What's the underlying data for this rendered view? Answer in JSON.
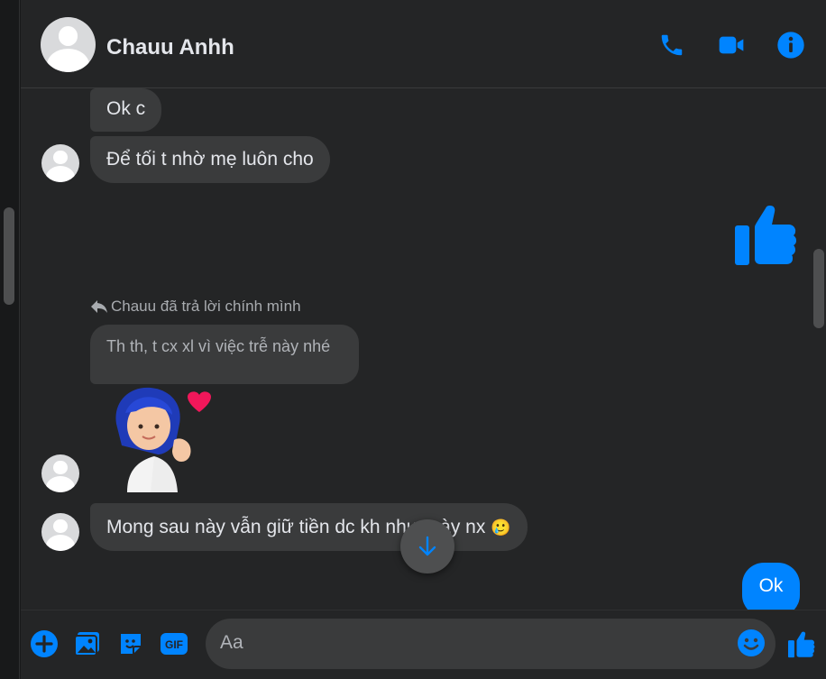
{
  "conversation": {
    "contact_name": "Chauu Anhh",
    "actions": [
      {
        "name": "call",
        "icon": "phone-icon"
      },
      {
        "name": "video",
        "icon": "video-camera-icon"
      },
      {
        "name": "info",
        "icon": "info-icon"
      }
    ]
  },
  "messages": {
    "m1": "Ok c",
    "m2": "Để tối t nhờ mẹ luôn cho",
    "reply_indicator": "Chauu đã trả lời chính mình",
    "m3_quoted": "Th th, t cx xl vì việc trễ này nhé",
    "m4": "Mong sau này vẫn giữ tiền dc kh nhưt này nx",
    "m4_emoji": "🥲",
    "sent_ok": "Ok",
    "sent_sticker": "thumbs-up-icon",
    "received_sticker": "blue-hair-girl-heart-sticker"
  },
  "composer": {
    "placeholder": "Aa",
    "buttons": [
      "plus-icon",
      "image-icon",
      "sticker-icon",
      "gif-icon",
      "emoji-icon",
      "thumbs-up-icon"
    ],
    "gif_label": "GIF"
  },
  "colors": {
    "accent": "#0084ff",
    "background": "#242526",
    "bubble_received": "#3a3b3c"
  }
}
